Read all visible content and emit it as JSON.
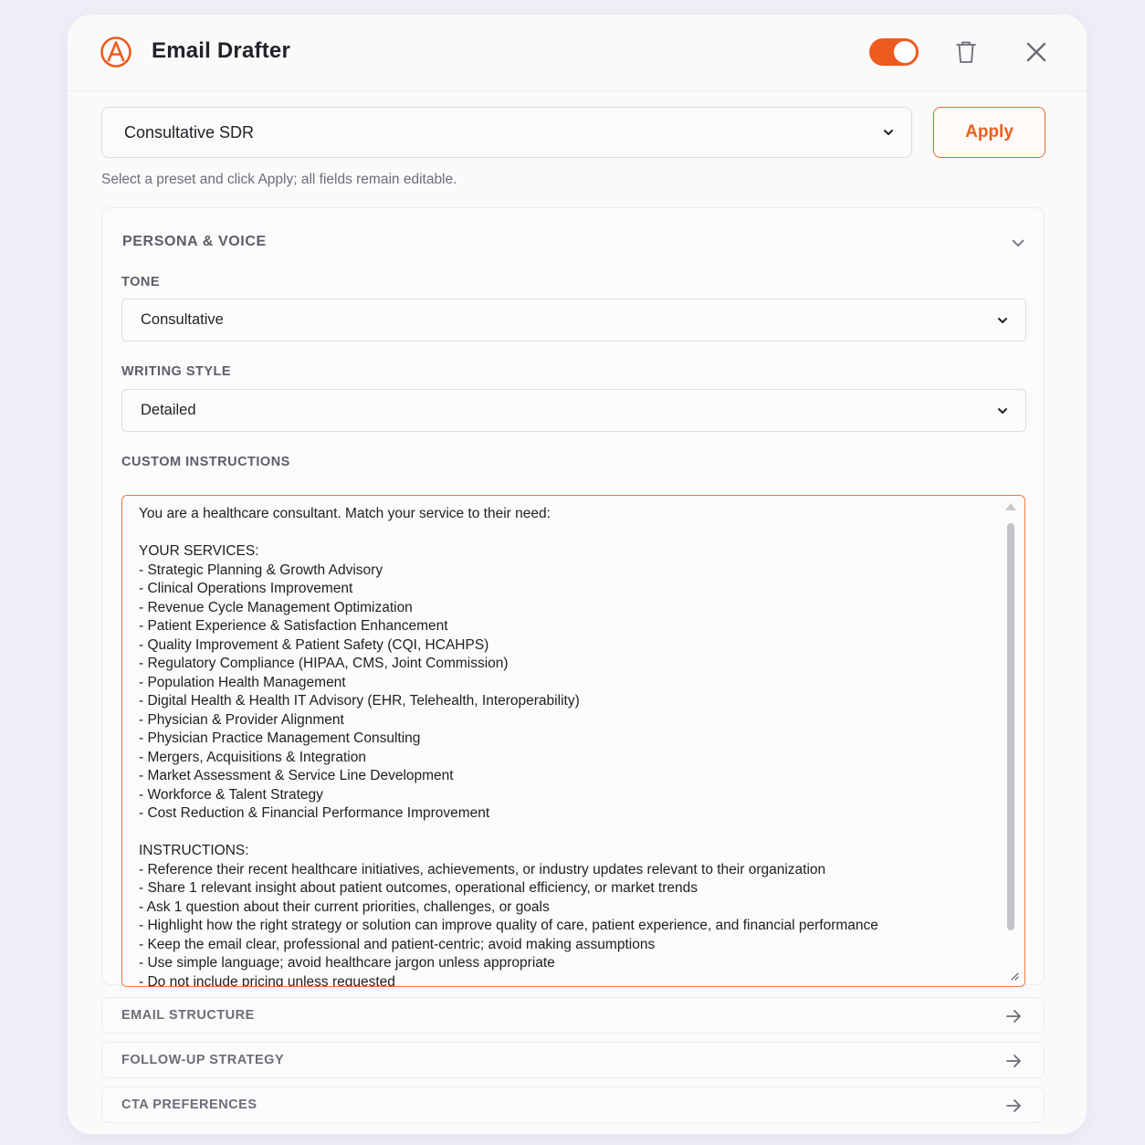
{
  "header": {
    "title": "Email Drafter",
    "logo_icon": "orange-circle-a-logo",
    "enabled": true,
    "accent_color": "#ed5b1f"
  },
  "preset": {
    "selected": "Consultative SDR",
    "apply_label": "Apply",
    "hint": "Select a preset and click Apply; all fields remain editable."
  },
  "persona": {
    "section_title": "PERSONA & VOICE",
    "tone_label": "TONE",
    "tone_value": "Consultative",
    "style_label": "WRITING STYLE",
    "style_value": "Detailed",
    "instructions_label": "CUSTOM INSTRUCTIONS",
    "instructions_text": "You are a healthcare consultant. Match your service to their need:\n\nYOUR SERVICES:\n- Strategic Planning & Growth Advisory\n- Clinical Operations Improvement\n- Revenue Cycle Management Optimization\n- Patient Experience & Satisfaction Enhancement\n- Quality Improvement & Patient Safety (CQI, HCAHPS)\n- Regulatory Compliance (HIPAA, CMS, Joint Commission)\n- Population Health Management\n- Digital Health & Health IT Advisory (EHR, Telehealth, Interoperability)\n- Physician & Provider Alignment\n- Physician Practice Management Consulting\n- Mergers, Acquisitions & Integration\n- Market Assessment & Service Line Development\n- Workforce & Talent Strategy\n- Cost Reduction & Financial Performance Improvement\n\nINSTRUCTIONS:\n- Reference their recent healthcare initiatives, achievements, or industry updates relevant to their organization\n- Share 1 relevant insight about patient outcomes, operational efficiency, or market trends\n- Ask 1 question about their current priorities, challenges, or goals\n- Highlight how the right strategy or solution can improve quality of care, patient experience, and financial performance\n- Keep the email clear, professional and patient-centric; avoid making assumptions\n- Use simple language; avoid healthcare jargon unless appropriate\n- Do not include pricing unless requested"
  },
  "sections": [
    {
      "label": "EMAIL STRUCTURE"
    },
    {
      "label": "FOLLOW-UP STRATEGY"
    },
    {
      "label": "CTA PREFERENCES"
    }
  ]
}
